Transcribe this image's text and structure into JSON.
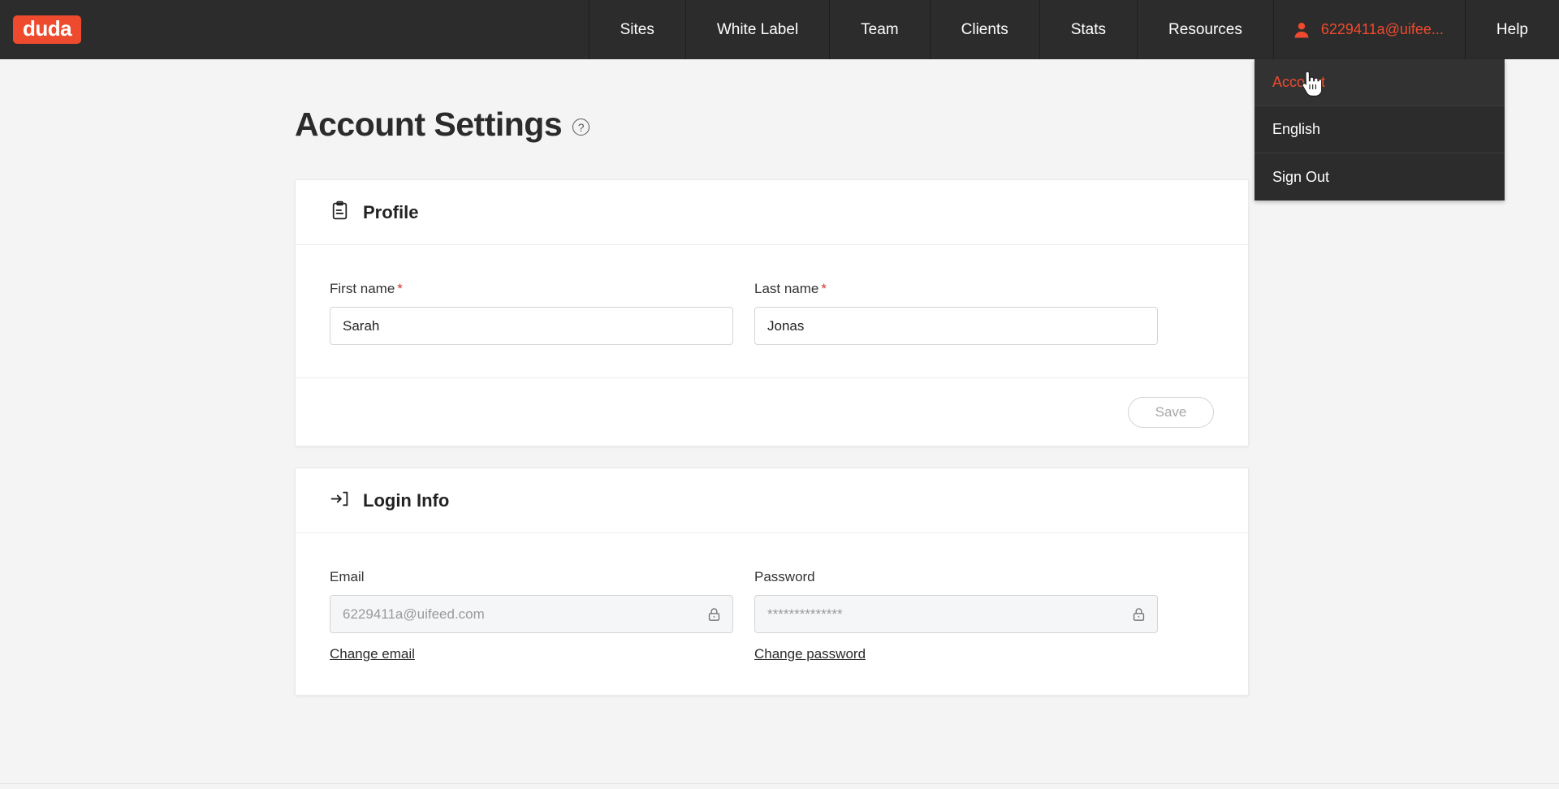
{
  "brand": {
    "logo_text": "duda",
    "accent_color": "#ee4b2e",
    "nav_bg": "#2c2c2c",
    "page_bg": "#f4f4f4"
  },
  "topnav": {
    "items": [
      {
        "label": "Sites",
        "icon": ""
      },
      {
        "label": "White Label",
        "icon": ""
      },
      {
        "label": "Team",
        "icon": ""
      },
      {
        "label": "Clients",
        "icon": ""
      },
      {
        "label": "Stats",
        "icon": ""
      },
      {
        "label": "Resources",
        "icon": ""
      }
    ],
    "account": {
      "label": "6229411a@uifee...",
      "icon": "person-icon"
    },
    "help": {
      "label": "Help"
    }
  },
  "account_menu": {
    "items": [
      {
        "label": "Account",
        "active": true
      },
      {
        "label": "English",
        "active": false
      },
      {
        "label": "Sign Out",
        "active": false
      }
    ]
  },
  "page": {
    "title": "Account Settings",
    "help_icon": "question-mark-circle-icon"
  },
  "profile_card": {
    "icon": "clipboard-icon",
    "title": "Profile",
    "first_name": {
      "label": "First name",
      "required": "*",
      "value": "Sarah",
      "placeholder": "First name"
    },
    "last_name": {
      "label": "Last name",
      "required": "*",
      "value": "Jonas",
      "placeholder": "Last name"
    },
    "save_label": "Save"
  },
  "login_card": {
    "icon": "login-arrow-icon",
    "title": "Login Info",
    "email": {
      "label": "Email",
      "value": "6229411a@uifeed.com",
      "lock_icon": "lock-icon",
      "change_link": "Change email"
    },
    "password": {
      "label": "Password",
      "value": "**************",
      "lock_icon": "lock-icon",
      "change_link": "Change password"
    }
  }
}
